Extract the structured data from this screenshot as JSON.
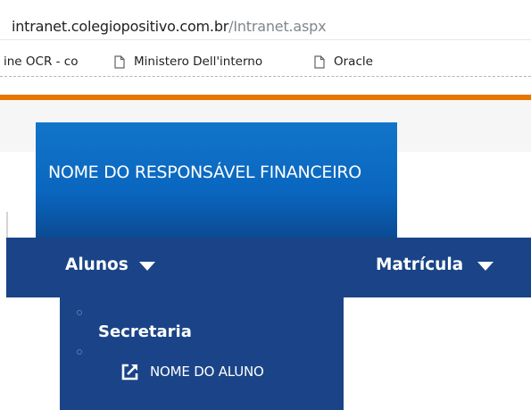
{
  "browser": {
    "url_domain": "intranet.colegiopositivo.com.br",
    "url_path": "/Intranet.aspx",
    "bookmarks": [
      {
        "label": "ine OCR - co",
        "icon": "page-icon"
      },
      {
        "label": "Ministero Dell'interno",
        "icon": "page-icon"
      },
      {
        "label": "Oracle",
        "icon": "page-icon"
      }
    ]
  },
  "header": {
    "responsible_label": "NOME DO RESPONSÁVEL FINANCEIRO"
  },
  "nav": {
    "items": [
      {
        "label": "Alunos",
        "icon": "caret-down-icon"
      },
      {
        "label": "Matrícula",
        "icon": "caret-down-icon"
      }
    ]
  },
  "submenu": {
    "heading": "Secretaria",
    "link": {
      "label": "NOME DO ALUNO",
      "icon": "external-link-icon"
    }
  },
  "colors": {
    "orange_strip": "#e87500",
    "responsible_box": "#0a66bf",
    "navbar": "#1a4487"
  }
}
